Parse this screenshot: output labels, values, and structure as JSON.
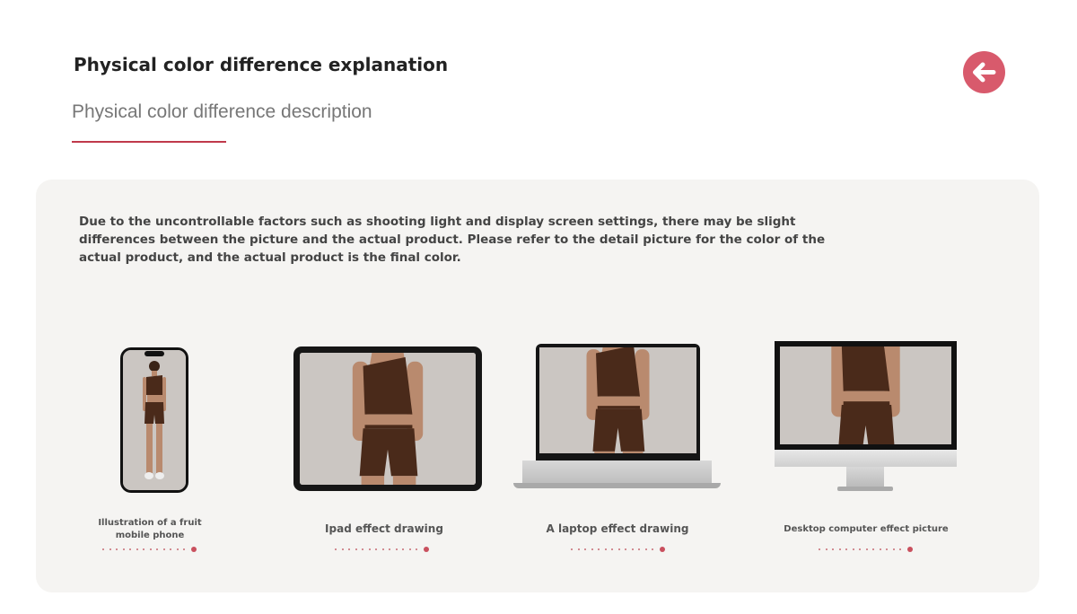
{
  "header": {
    "title": "Physical color difference explanation",
    "subtitle": "Physical color difference description",
    "back_icon": "arrow-left-icon",
    "accent": "#c0394b"
  },
  "description": "Due to the uncontrollable factors such as shooting light and display screen settings, there may be slight differences between the picture and the actual product. Please refer to the detail picture for the color of the actual product, and the actual product is the final color.",
  "devices": [
    {
      "caption": "Illustration of a fruit mobile phone"
    },
    {
      "caption": "Ipad effect drawing"
    },
    {
      "caption": "A laptop effect drawing"
    },
    {
      "caption": "Desktop computer effect picture"
    }
  ]
}
